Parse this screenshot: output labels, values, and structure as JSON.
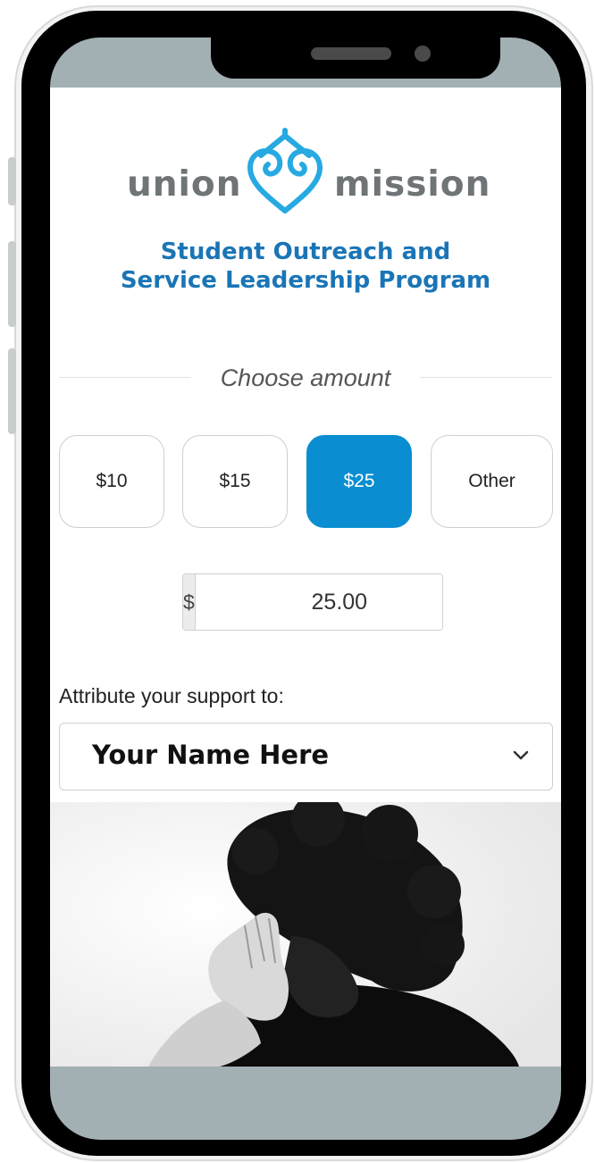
{
  "brand": {
    "logo_left": "union",
    "logo_right": "mission",
    "program_title_line1": "Student Outreach and",
    "program_title_line2": "Service Leadership Program",
    "brand_blue": "#1a75b6",
    "heart_color": "#27a9e1",
    "logo_gray": "#6f7477"
  },
  "donation": {
    "section_label": "Choose amount",
    "amounts": [
      "$10",
      "$15",
      "$25",
      "Other"
    ],
    "selected_amount": "$25",
    "accent_color": "#0a8ed1",
    "currency_symbol": "$",
    "amount_value": "25.00"
  },
  "attribution": {
    "label": "Attribute your support to:",
    "selected_value": "Your Name Here"
  },
  "device": {
    "frame_color": "#000000",
    "screen_bg": "#a2afb3"
  }
}
